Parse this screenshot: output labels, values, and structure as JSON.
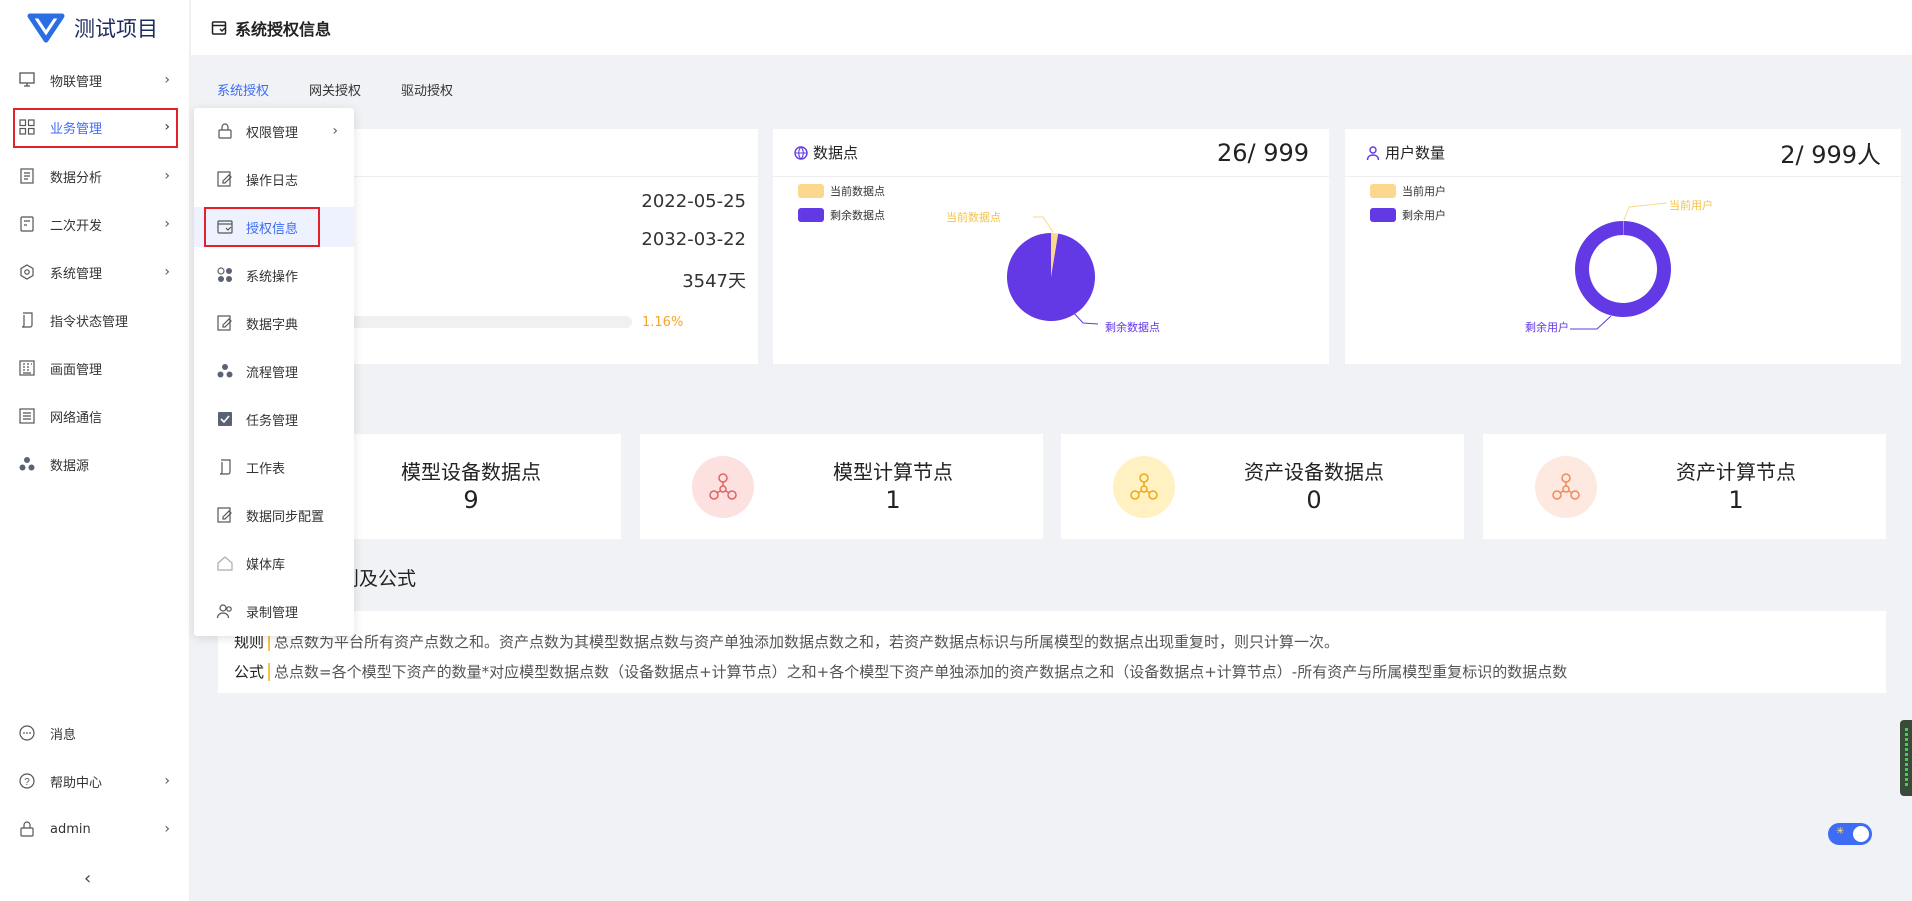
{
  "app": {
    "name": "测试项目"
  },
  "sidebar": {
    "items": [
      {
        "label": "物联管理",
        "icon": "iot-monitor-icon",
        "has_children": true
      },
      {
        "label": "业务管理",
        "icon": "grid-apps-icon",
        "has_children": true
      },
      {
        "label": "数据分析",
        "icon": "analysis-doc-icon",
        "has_children": true
      },
      {
        "label": "二次开发",
        "icon": "dev-doc-icon",
        "has_children": true
      },
      {
        "label": "系统管理",
        "icon": "settings-hex-icon",
        "has_children": true
      },
      {
        "label": "指令状态管理",
        "icon": "scroll-icon",
        "has_children": false
      },
      {
        "label": "画面管理",
        "icon": "building-icon",
        "has_children": false
      },
      {
        "label": "网络通信",
        "icon": "list-lines-icon",
        "has_children": false
      },
      {
        "label": "数据源",
        "icon": "dots-cluster-icon",
        "has_children": false
      }
    ],
    "bottom": [
      {
        "label": "消息",
        "icon": "chat-bubble-icon",
        "has_children": false
      },
      {
        "label": "帮助中心",
        "icon": "help-circle-icon",
        "has_children": true
      },
      {
        "label": "admin",
        "icon": "lock-user-icon",
        "has_children": true
      }
    ],
    "collapse_glyph": "‹"
  },
  "submenu": {
    "items": [
      {
        "label": "权限管理",
        "icon": "lock-icon",
        "has_children": true
      },
      {
        "label": "操作日志",
        "icon": "edit-doc-icon",
        "has_children": false
      },
      {
        "label": "授权信息",
        "icon": "license-icon",
        "has_children": false
      },
      {
        "label": "系统操作",
        "icon": "four-circles-icon",
        "has_children": false
      },
      {
        "label": "数据字典",
        "icon": "edit-doc-icon",
        "has_children": false
      },
      {
        "label": "流程管理",
        "icon": "three-dots-icon",
        "has_children": false
      },
      {
        "label": "任务管理",
        "icon": "check-square-icon",
        "has_children": false
      },
      {
        "label": "工作表",
        "icon": "scroll-icon",
        "has_children": false
      },
      {
        "label": "数据同步配置",
        "icon": "edit-doc-icon",
        "has_children": false
      },
      {
        "label": "媒体库",
        "icon": "house-icon",
        "has_children": false
      },
      {
        "label": "录制管理",
        "icon": "users-icon",
        "has_children": false
      }
    ]
  },
  "header": {
    "title": "系统授权信息"
  },
  "tabs": [
    "系统授权",
    "网关授权",
    "驱动授权"
  ],
  "license_card": {
    "start_date": "2022-05-25",
    "end_date": "2032-03-22",
    "remaining_days": "3547天",
    "progress_text": "1.16%",
    "progress_fraction": 0.0116
  },
  "datapoint_card": {
    "title": "数据点",
    "value": "26/ 999",
    "legend_current": "当前数据点",
    "legend_remaining": "剩余数据点",
    "label_current": "当前数据点",
    "label_remaining": "剩余数据点",
    "colors": {
      "current": "#fbd88e",
      "remaining": "#6338e5"
    }
  },
  "user_card": {
    "title": "用户数量",
    "value": "2/ 999人",
    "legend_current": "当前用户",
    "legend_remaining": "剩余用户",
    "label_current": "当前用户",
    "label_remaining": "剩余用户"
  },
  "chart_data": [
    {
      "type": "pie",
      "categories": [
        "当前数据点",
        "剩余数据点"
      ],
      "values": [
        26,
        973
      ]
    },
    {
      "type": "pie",
      "categories": [
        "当前用户",
        "剩余用户"
      ],
      "values": [
        2,
        997
      ]
    }
  ],
  "stats": [
    {
      "label": "模型设备数据点",
      "value": "9",
      "color": "#ffffff",
      "icon": ""
    },
    {
      "label": "模型计算节点",
      "value": "1",
      "color": "#fde1e1",
      "icon": "network-nodes-icon"
    },
    {
      "label": "资产设备数据点",
      "value": "0",
      "color": "#fff1c2",
      "icon": "network-nodes-icon"
    },
    {
      "label": "资产计算节点",
      "value": "1",
      "color": "#fde9df",
      "icon": "network-nodes-icon"
    }
  ],
  "rules": {
    "section_title_visible": "则及公式",
    "rule_key": "规则",
    "rule_text": "总点数为平台所有资产点数之和。资产点数为其模型数据点数与资产单独添加数据点数之和，若资产数据点标识与所属模型的数据点出现重复时，则只计算一次。",
    "formula_key": "公式",
    "formula_text": "总点数=各个模型下资产的数量*对应模型数据点数（设备数据点+计算节点）之和+各个模型下资产单独添加的资产数据点之和（设备数据点+计算节点）-所有资产与所属模型重复标识的数据点数"
  }
}
